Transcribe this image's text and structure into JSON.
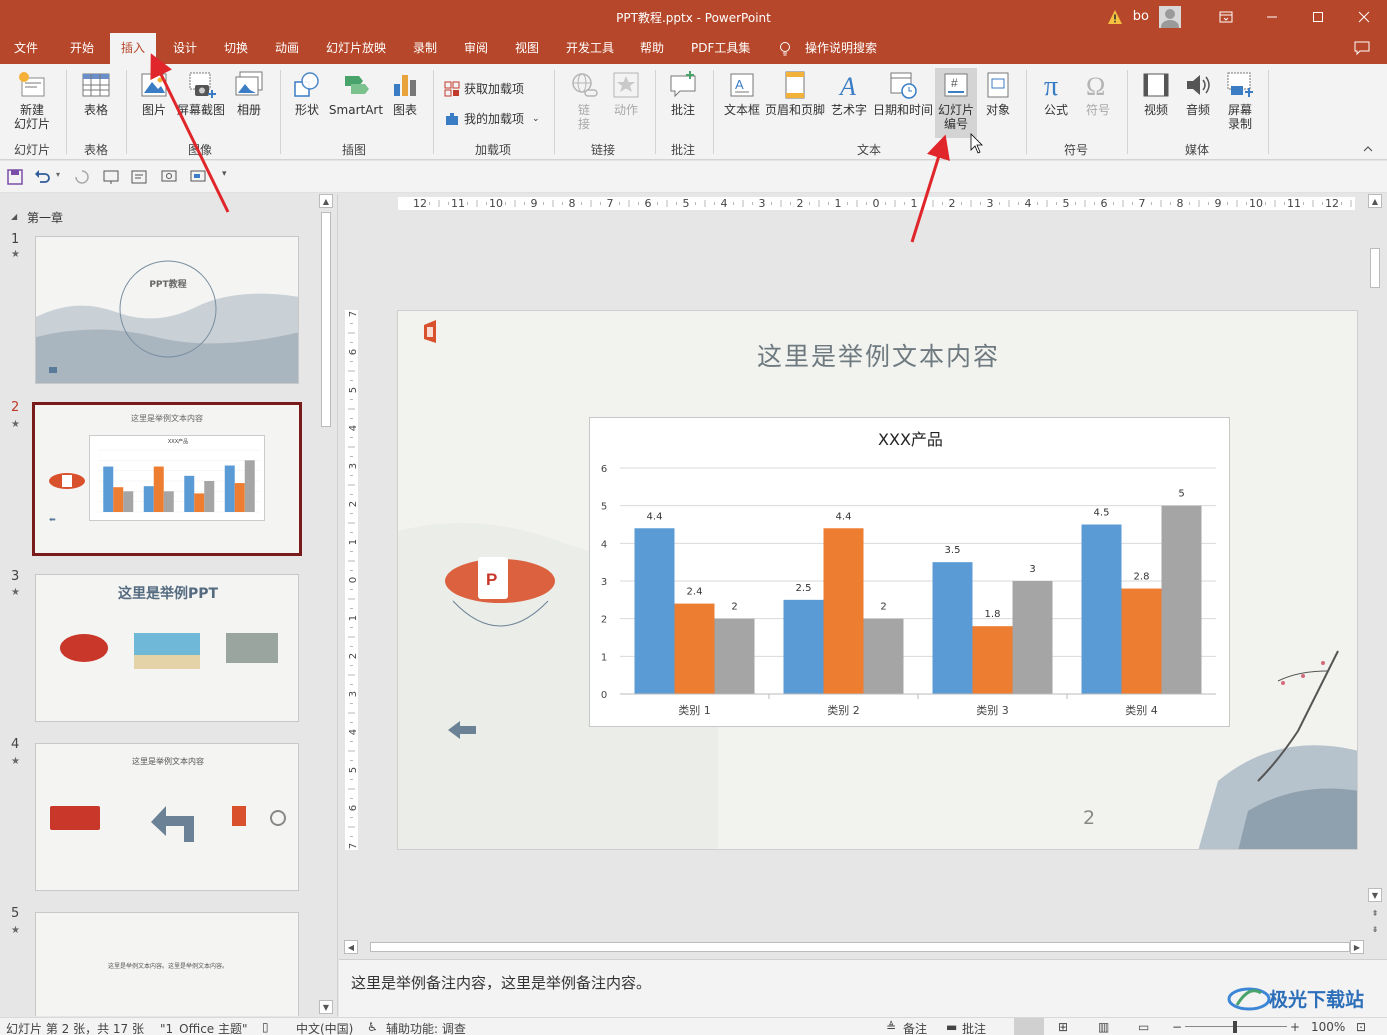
{
  "window": {
    "title": "PPT教程.pptx  -  PowerPoint",
    "user": "bo",
    "controls": [
      "ribbon-display",
      "minimize",
      "maximize",
      "close"
    ]
  },
  "menu": {
    "tabs": [
      "文件",
      "开始",
      "插入",
      "设计",
      "切换",
      "动画",
      "幻灯片放映",
      "录制",
      "审阅",
      "视图",
      "开发工具",
      "帮助",
      "PDF工具集"
    ],
    "active": "插入",
    "tell_me": "操作说明搜索"
  },
  "ribbon": {
    "new_slide": "新建\n幻灯片",
    "group_slides": "幻灯片",
    "table": "表格",
    "group_table": "表格",
    "picture": "图片",
    "screenshot": "屏幕截图",
    "album": "相册",
    "group_images": "图像",
    "shapes": "形状",
    "smartart": "SmartArt",
    "chart": "图表",
    "group_illustrations": "插图",
    "get_addins": "获取加载项",
    "my_addins": "我的加载项",
    "group_addins": "加载项",
    "link": "链\n接",
    "action": "动作",
    "group_links": "链接",
    "comment": "批注",
    "group_comments": "批注",
    "textbox": "文本框",
    "header_footer": "页眉和页脚",
    "wordart": "艺术字",
    "datetime": "日期和时间",
    "slide_number": "幻灯片\n编号",
    "object": "对象",
    "group_text": "文本",
    "equation": "公式",
    "symbol": "符号",
    "group_symbols": "符号",
    "video": "视频",
    "audio": "音频",
    "screen_recording": "屏幕\n录制",
    "group_media": "媒体"
  },
  "thumbnails": {
    "section": "第一章",
    "slides": [
      {
        "num": "1",
        "title": "PPT教程"
      },
      {
        "num": "2",
        "title": "这里是举例文本内容",
        "chart_title": "XXX产品"
      },
      {
        "num": "3",
        "title": "这里是举例PPT"
      },
      {
        "num": "4",
        "title": "这里是举例文本内容"
      },
      {
        "num": "5",
        "title": "这里是举例文本内容。这里是举例文本内容。"
      }
    ]
  },
  "slide": {
    "title": "这里是举例文本内容",
    "number": "2"
  },
  "ruler": {
    "h_labels": [
      "12",
      "11",
      "10",
      "9",
      "8",
      "7",
      "6",
      "5",
      "4",
      "3",
      "2",
      "1",
      "0",
      "1",
      "2",
      "3",
      "4",
      "5",
      "6",
      "7",
      "8",
      "9",
      "10",
      "11",
      "12"
    ],
    "v_labels": [
      "7",
      "6",
      "5",
      "4",
      "3",
      "2",
      "1",
      "0",
      "1",
      "2",
      "3",
      "4",
      "5",
      "6",
      "7"
    ]
  },
  "chart_data": {
    "type": "bar",
    "title": "XXX产品",
    "categories": [
      "类别 1",
      "类别 2",
      "类别 3",
      "类别 4"
    ],
    "series": [
      {
        "values": [
          4.4,
          2.5,
          3.5,
          4.5
        ],
        "color": "#5b9bd5"
      },
      {
        "values": [
          2.4,
          4.4,
          1.8,
          2.8
        ],
        "color": "#ed7d31"
      },
      {
        "values": [
          2,
          2,
          3,
          5
        ],
        "color": "#a5a5a5"
      }
    ],
    "ylim": [
      0,
      6
    ],
    "yticks": [
      "0",
      "1",
      "2",
      "3",
      "4",
      "5",
      "6"
    ],
    "grid": true,
    "data_labels": true
  },
  "notes": "这里是举例备注内容，这里是举例备注内容。",
  "status": {
    "slide_info": "幻灯片 第 2 张，共 17 张",
    "theme": "\"1_Office 主题\"",
    "language": "中文(中国)",
    "accessibility": "辅助功能: 调查",
    "notes_btn": "备注",
    "comments_btn": "批注",
    "zoom": "100%"
  },
  "watermark": "极光下载站",
  "colors": {
    "accent": "#b7472a",
    "ribbon_bg": "#f3f3f3",
    "selected_thumb_border": "#7a1b1b",
    "annotation_arrow": "#e0262a"
  }
}
